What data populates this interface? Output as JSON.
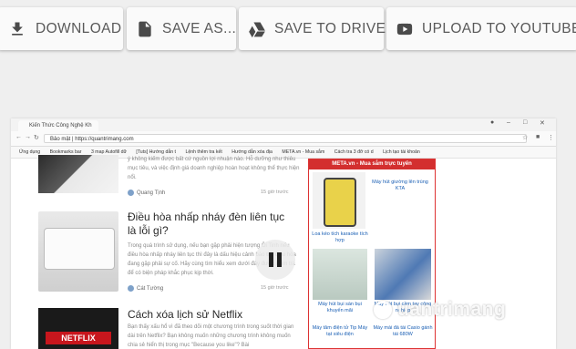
{
  "toolbar": {
    "download_label": "DOWNLOAD",
    "save_as_label": "SAVE AS...",
    "save_drive_label": "SAVE TO DRIVE",
    "upload_youtube_label": "UPLOAD TO YOUTUBE"
  },
  "browser": {
    "tab_title": "Kiến Thức Công Nghệ Kh",
    "address": "Bảo mật | https://quantrimang.com",
    "bookmarks": [
      "Ứng dụng",
      "Bookmarks bar",
      "3 map Autofill dữ",
      "[Tuts] Hướng dẫn t",
      "Lệnh thêm tra kết",
      "Hướng dẫn xóa địa",
      "META.vn - Mua sắm",
      "Cách tra 3 đỡ có d",
      "Lịch tạo tài khoản"
    ]
  },
  "articles": [
    {
      "snippet": "ý không kiếm được bất cứ nguồn lợi nhuận nào. Hỗ dưỡng như thiêu mục tiêu, và việc định giá doanh nghiệp hoàn hoạt không thể thực hiện nổi.",
      "author": "Quang Tịnh",
      "time": "15 giờ trước"
    },
    {
      "title": "Điều hòa nhấp nháy đèn liên tục là lỗi gì?",
      "snippet": "Trong quá trình sử dụng, nếu bạn gặp phải hiện tượng Ôi Tinh nếu điều hòa nhấp nháy liên tục thì đây là dấu hiệu cảnh báo tiết điều hòa đang gặp phải sự cố. Hãy cùng tìm hiểu xem dưới đây được kiểm tra để có biện pháp khắc phục kịp thời.",
      "author": "Cát Tường",
      "time": "15 giờ trước"
    },
    {
      "title": "Cách xóa lịch sử Netflix",
      "snippet": "Bạn thấy xấu hổ vì đã theo dõi một chương trình trong suốt thời gian dài trên Netflix? Bạn không muốn những chương trình không muốn chia sẻ hiển thị trong mục \"Because you like\"? Bài"
    }
  ],
  "sidebar_ad": {
    "header": "META.vn - Mua sắm trực tuyến",
    "products": [
      "Máy hút giường lên trùng KTA",
      "Loa kéo tích karaoke tích hợp",
      "Máy hút bụi sàn bụi khuyến mãi",
      "Máy hút bụi cầm tay công nghiệp",
      "Máy tăm điện tử Tip Máy tạt siêu điện",
      "Máy mài đá tài Casio gánh tái 680W"
    ]
  },
  "watermark": "uantrimang",
  "colors": {
    "button_bg": "#fafafa",
    "button_text": "#595959",
    "ad_red": "#d32f2f"
  }
}
